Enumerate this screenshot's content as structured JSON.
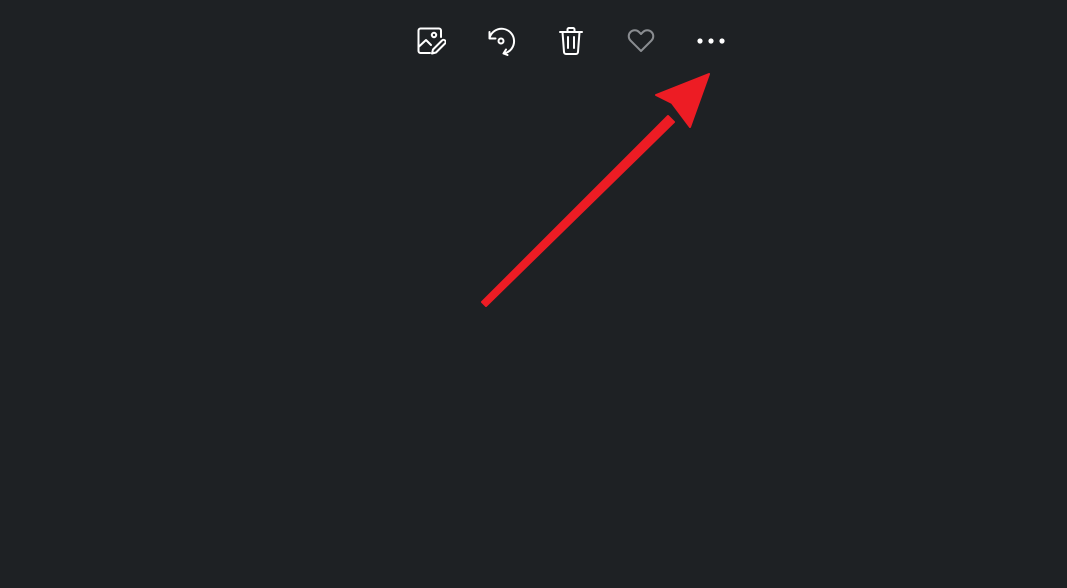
{
  "toolbar": {
    "buttons": [
      {
        "id": "edit",
        "icon": "edit-image-icon",
        "color": "#ffffff"
      },
      {
        "id": "rotate",
        "icon": "rotate-icon",
        "color": "#ffffff"
      },
      {
        "id": "delete",
        "icon": "trash-icon",
        "color": "#ffffff"
      },
      {
        "id": "favorite",
        "icon": "heart-icon",
        "color": "#8a8d91"
      },
      {
        "id": "more",
        "icon": "more-options-icon",
        "color": "#ffffff"
      }
    ]
  },
  "annotation": {
    "type": "arrow",
    "color": "#ed1c24",
    "points_to": "more-options-button"
  },
  "colors": {
    "background": "#1e2124"
  }
}
